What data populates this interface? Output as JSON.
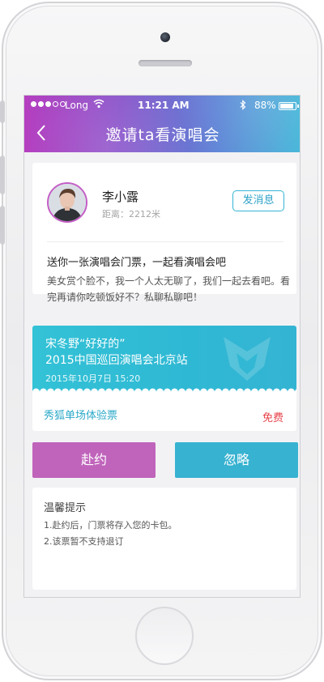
{
  "status_bar": {
    "carrier": "Long",
    "time": "11:21 AM",
    "battery": "88%"
  },
  "nav": {
    "title": "邀请ta看演唱会"
  },
  "profile": {
    "name": "李小露",
    "distance": "距离：2212米",
    "message_button": "发消息",
    "invite_title": "送你一张演唱会门票，一起看演唱会吧",
    "invite_body": "美女赏个脸不，我一个人太无聊了，我们一起去看吧。看完再请你吃顿饭好不？私聊私聊吧！"
  },
  "ticket": {
    "artist": "宋冬野“好好的”",
    "show": "2015中国巡回演唱会北京站",
    "datetime": "2015年10月7日   15:20",
    "type": "秀狐单场体验票",
    "price": "免费"
  },
  "actions": {
    "accept": "赴约",
    "ignore": "忽略"
  },
  "tips": {
    "title": "温馨提示",
    "items": [
      "1.赴约后，门票将存入您的卡包。",
      "2.该票暂不支持退订"
    ]
  },
  "colors": {
    "nav_gradient_start": "#b53fc0",
    "nav_gradient_end": "#43b6d8",
    "accept_button": "#c064bb",
    "ignore_button": "#37b2d1",
    "ticket_band": "#33c2d6",
    "price": "#e8434a"
  }
}
